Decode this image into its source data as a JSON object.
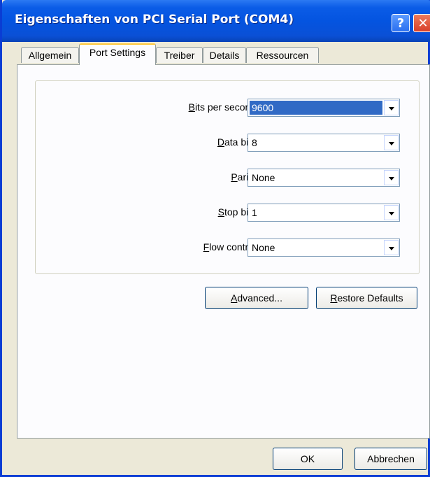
{
  "window": {
    "title": "Eigenschaften von PCI Serial Port (COM4)",
    "help_glyph": "?",
    "close_glyph": "✕"
  },
  "tabs": [
    {
      "label": "Allgemein",
      "active": false
    },
    {
      "label": "Port Settings",
      "active": true
    },
    {
      "label": "Treiber",
      "active": false
    },
    {
      "label": "Details",
      "active": false
    },
    {
      "label": "Ressourcen",
      "active": false
    }
  ],
  "settings": {
    "bits_per_second": {
      "label": "Bits per second:",
      "mnemonic": "B",
      "label_rest": "its per second:",
      "value": "9600"
    },
    "data_bits": {
      "label": "Data bits:",
      "mnemonic": "D",
      "label_rest": "ata bits:",
      "value": "8"
    },
    "parity": {
      "label": "Parity:",
      "mnemonic": "P",
      "label_rest": "arity:",
      "value": "None"
    },
    "stop_bits": {
      "label": "Stop bits:",
      "mnemonic": "S",
      "label_rest": "top bits:",
      "value": "1"
    },
    "flow_control": {
      "label": "Flow control:",
      "mnemonic": "F",
      "label_rest": "low control:",
      "value": "None"
    }
  },
  "buttons": {
    "advanced": {
      "mnemonic": "A",
      "rest": "dvanced..."
    },
    "restore": {
      "mnemonic": "R",
      "rest": "estore Defaults"
    },
    "ok": "OK",
    "cancel": "Abbrechen"
  }
}
